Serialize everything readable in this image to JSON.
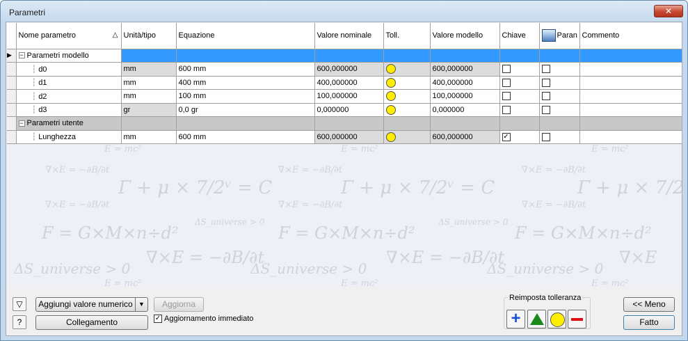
{
  "window": {
    "title": "Parametri",
    "close_glyph": "✕"
  },
  "columns": {
    "name": "Nome parametro",
    "unit": "Unità/tipo",
    "equation": "Equazione",
    "nominal": "Valore nominale",
    "tol": "Toll.",
    "model_value": "Valore modello",
    "key": "Chiave",
    "export": "Paran",
    "comment": "Commento"
  },
  "groups": [
    {
      "name": "Parametri modello",
      "selected": true,
      "rows": [
        {
          "name": "d0",
          "unit": "mm",
          "equation": "600 mm",
          "nominal": "600,000000",
          "model_value": "600,000000",
          "key": false,
          "export": false,
          "comment": ""
        },
        {
          "name": "d1",
          "unit": "mm",
          "equation": "400 mm",
          "nominal": "400,000000",
          "model_value": "400,000000",
          "key": false,
          "export": false,
          "comment": ""
        },
        {
          "name": "d2",
          "unit": "mm",
          "equation": "100 mm",
          "nominal": "100,000000",
          "model_value": "100,000000",
          "key": false,
          "export": false,
          "comment": ""
        },
        {
          "name": "d3",
          "unit": "gr",
          "equation": "0,0 gr",
          "nominal": "0,000000",
          "model_value": "0,000000",
          "key": false,
          "export": false,
          "comment": ""
        }
      ]
    },
    {
      "name": "Parametri utente",
      "selected": false,
      "rows": [
        {
          "name": "Lunghezza",
          "unit": "mm",
          "equation": "600 mm",
          "nominal": "600,000000",
          "model_value": "600,000000",
          "key": true,
          "export": false,
          "comment": ""
        }
      ]
    }
  ],
  "bottom": {
    "add_numeric": "Aggiungi valore numerico",
    "update": "Aggiorna",
    "link": "Collegamento",
    "immediate_update": "Aggiornamento immediato",
    "immediate_update_checked": true,
    "reset_tolerance": "Reimposta tolleranza",
    "less": "<< Meno",
    "done": "Fatto"
  },
  "icons": {
    "filter": "filter-icon",
    "help": "help-icon",
    "export_header": "export-parameter-icon",
    "tol_upper": "plus-icon",
    "tol_median": "triangle-icon",
    "tol_nominal": "circle-icon",
    "tol_lower": "minus-icon"
  },
  "colors": {
    "selection": "#3399ff",
    "tolerance_dot": "#ffee00",
    "category_row": "#c8c8c8"
  }
}
